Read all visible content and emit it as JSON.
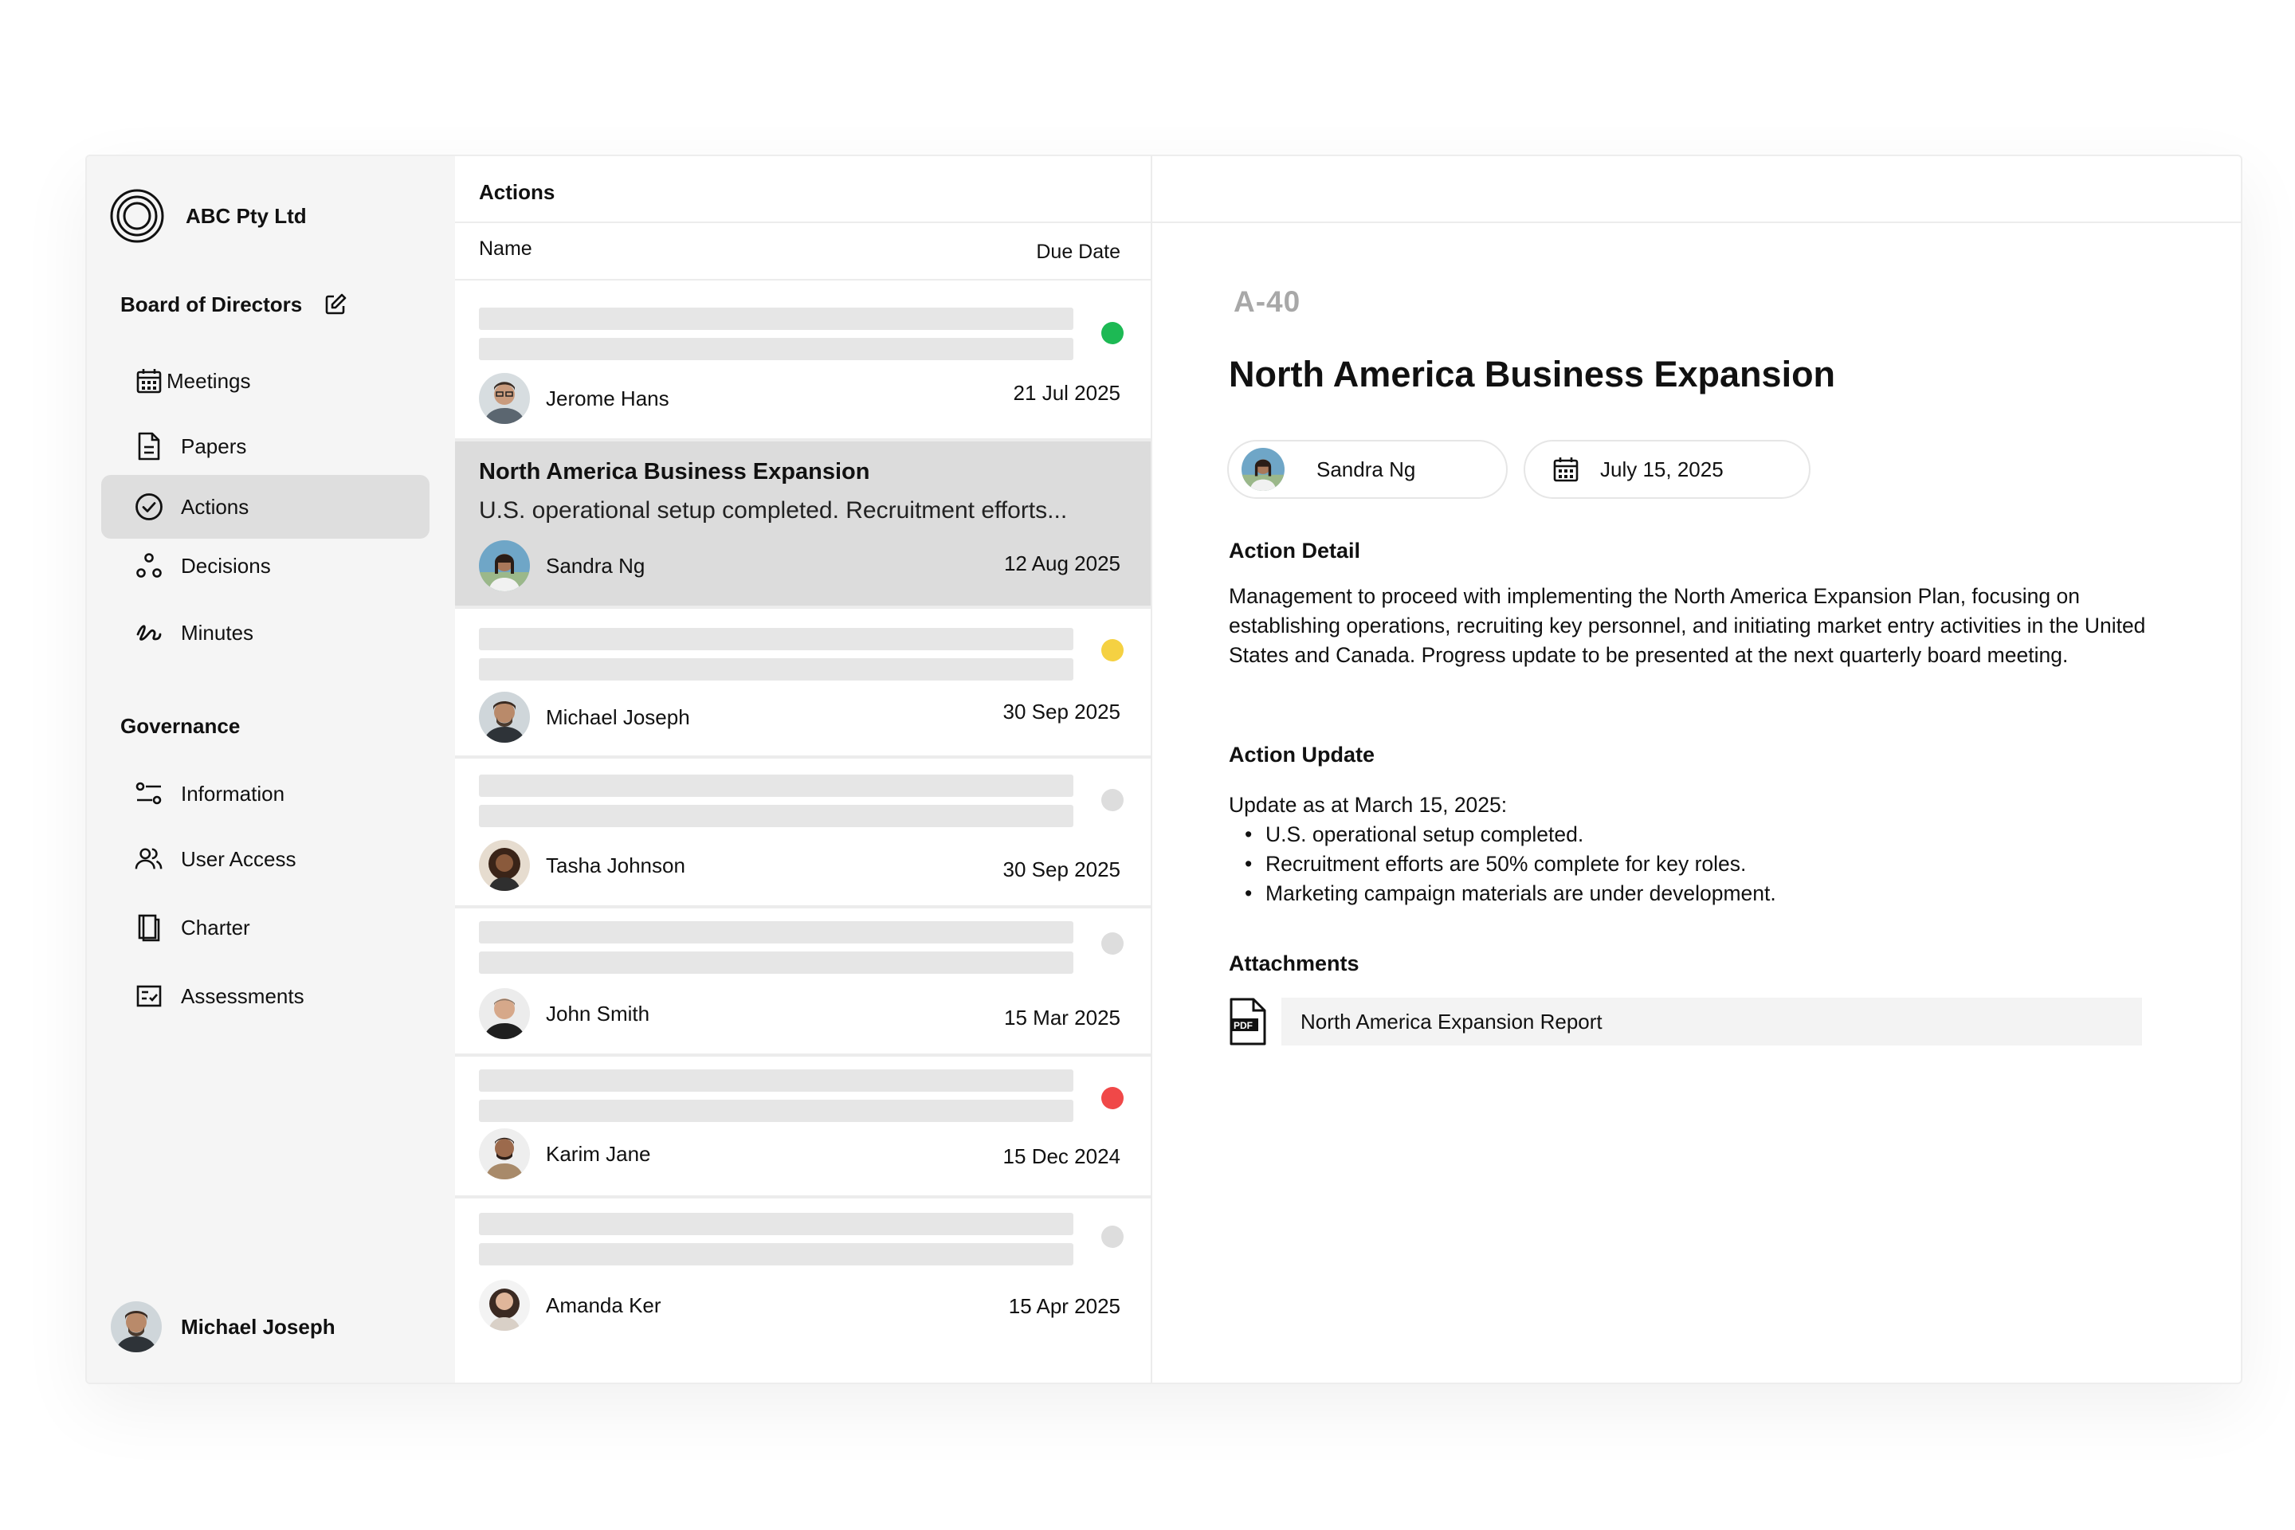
{
  "org": {
    "name": "ABC Pty Ltd"
  },
  "board": {
    "title": "Board of Directors"
  },
  "nav_main": [
    {
      "label": "Meetings",
      "icon": "calendar-icon"
    },
    {
      "label": "Papers",
      "icon": "document-icon"
    },
    {
      "label": "Actions",
      "icon": "check-circle-icon",
      "active": true
    },
    {
      "label": "Decisions",
      "icon": "decisions-icon"
    },
    {
      "label": "Minutes",
      "icon": "signature-icon"
    }
  ],
  "governance": {
    "title": "Governance",
    "items": [
      {
        "label": "Information",
        "icon": "sliders-icon"
      },
      {
        "label": "User Access",
        "icon": "users-icon"
      },
      {
        "label": "Charter",
        "icon": "book-icon"
      },
      {
        "label": "Assessments",
        "icon": "checklist-icon"
      }
    ]
  },
  "current_user": {
    "name": "Michael Joseph"
  },
  "list": {
    "title": "Actions",
    "col_name": "Name",
    "col_due": "Due Date",
    "rows": [
      {
        "person": "Jerome Hans",
        "due": "21 Jul 2025",
        "status_color": "#1db954"
      },
      {
        "person": "Sandra Ng",
        "due": "12 Aug 2025",
        "title": "North America Business Expansion",
        "summary": "U.S. operational setup completed. Recruitment efforts...",
        "selected": true
      },
      {
        "person": "Michael Joseph",
        "due": "30 Sep 2025",
        "status_color": "#f5d142"
      },
      {
        "person": "Tasha Johnson",
        "due": "30 Sep 2025",
        "status_color": "#dddddd"
      },
      {
        "person": "John Smith",
        "due": "15 Mar 2025",
        "status_color": "#dddddd"
      },
      {
        "person": "Karim Jane",
        "due": "15 Dec 2024",
        "status_color": "#f04848"
      },
      {
        "person": "Amanda Ker",
        "due": "15 Apr 2025",
        "status_color": "#dddddd"
      }
    ]
  },
  "detail": {
    "code": "A-40",
    "title": "North America Business Expansion",
    "assignee": "Sandra Ng",
    "due_date": "July 15, 2025",
    "action_detail_heading": "Action Detail",
    "action_detail": "Management to proceed with implementing the North America Expansion Plan, focusing on establishing operations, recruiting key personnel, and initiating market entry activities in the United States and Canada. Progress update to be presented at the next quarterly board meeting.",
    "action_update_heading": "Action Update",
    "update_intro": "Update as at March 15, 2025:",
    "update_items": [
      "U.S. operational setup completed.",
      "Recruitment efforts are 50% complete for key roles.",
      "Marketing campaign materials are under development."
    ],
    "attachments_heading": "Attachments",
    "attachment_name": "North America Expansion Report"
  }
}
